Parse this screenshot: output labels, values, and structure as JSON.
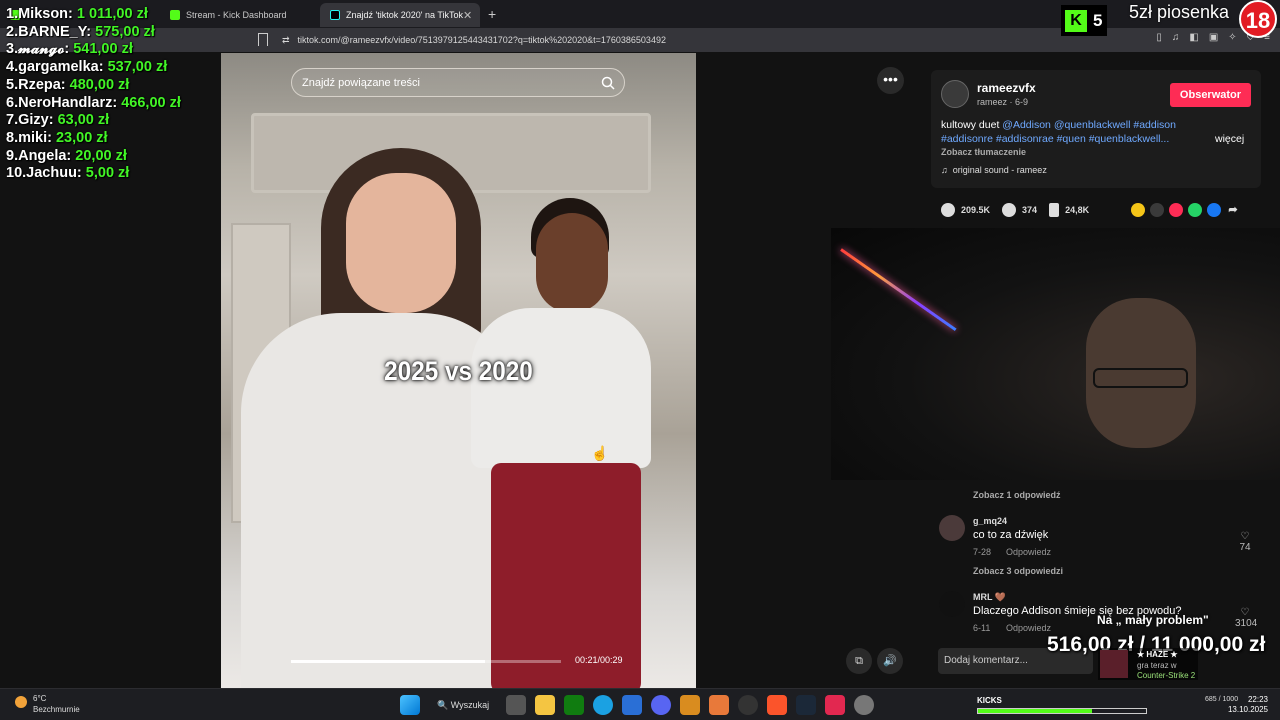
{
  "browser": {
    "tabs": [
      {
        "label": "",
        "icon": "kick-icon",
        "active": false
      },
      {
        "label": "Stream - Kick Dashboard",
        "icon": "kick-icon",
        "active": false
      },
      {
        "label": "Znajdź 'tiktok 2020' na TikTok",
        "icon": "tiktok-icon",
        "active": true
      }
    ],
    "url": "tiktok.com/@rameezvfx/video/7513979125443431702?q=tiktok%202020&t=1760386503492"
  },
  "leaderboard": [
    {
      "rank": "1.",
      "name": "Mikson:",
      "amount": "1 011,00 zł"
    },
    {
      "rank": "2.",
      "name": "BARNE_Y:",
      "amount": "575,00 zł"
    },
    {
      "rank": "3.",
      "name": "𝓶𝓪𝓷𝓰𝓸:",
      "amount": "541,00 zł"
    },
    {
      "rank": "4.",
      "name": "gargamelka:",
      "amount": "537,00 zł"
    },
    {
      "rank": "5.",
      "name": "Rzepa:",
      "amount": "480,00 zł"
    },
    {
      "rank": "6.",
      "name": "NeroHandlarz:",
      "amount": "466,00 zł"
    },
    {
      "rank": "7.",
      "name": "Gizy:",
      "amount": "63,00 zł"
    },
    {
      "rank": "8.",
      "name": "miki:",
      "amount": "23,00 zł"
    },
    {
      "rank": "9.",
      "name": "Angela:",
      "amount": "20,00 zł"
    },
    {
      "rank": "10.",
      "name": "Jachuu:",
      "amount": "5,00 zł"
    }
  ],
  "video": {
    "search_placeholder": "Znajdź powiązane treści",
    "overlay_text": "2025 vs 2020",
    "time": "00:21/00:29",
    "progress": 0.72
  },
  "post": {
    "username": "rameezvfx",
    "subline": "rameez · 6-9",
    "follow_label": "Obserwator",
    "desc_prefix": "kultowy duet",
    "desc_tags_line1": "@Addison @quenblackwell #addison",
    "desc_tags_line2": "#addisonre #addisonrae #quen #quenblackwell...",
    "more_label": "więcej",
    "translate_label": "Zobacz tłumaczenie",
    "sound": "original sound - rameez",
    "likes": "209.5K",
    "comments": "374",
    "saves": "24,8K"
  },
  "comments": {
    "replies_1": "Zobacz 1 odpowiedź",
    "items": [
      {
        "user": "g_mq24",
        "text": "co to za dźwięk",
        "date": "7-28",
        "reply": "Odpowiedz",
        "likes": "74"
      },
      {
        "user": "MRL 🤎",
        "text": "Dlaczego Addison śmieje się bez powodu?",
        "date": "6-11",
        "reply": "Odpowiedz",
        "likes": "3104"
      }
    ],
    "replies_3": "Zobacz 3 odpowiedzi",
    "input_placeholder": "Dodaj komentarz..."
  },
  "overlays": {
    "kick_count": "5",
    "song_label": "5zł piosenka",
    "age_label": "18",
    "mp_label": "Na „ mały problem\"",
    "goal_text": "516,00 zł / 11 000,00 zł",
    "np_title": "★ HAZE ★",
    "np_sub": "gra teraz w",
    "np_game": "Counter-Strike 2"
  },
  "taskbar": {
    "temp": "6°C",
    "weather": "Bezchmurnie",
    "search_label": "Wyszukaj",
    "kicks_label": "KICKS",
    "kicks_progress": 0.68,
    "counter": "685 / 1000",
    "time": "22:23",
    "date": "13.10.2025"
  }
}
